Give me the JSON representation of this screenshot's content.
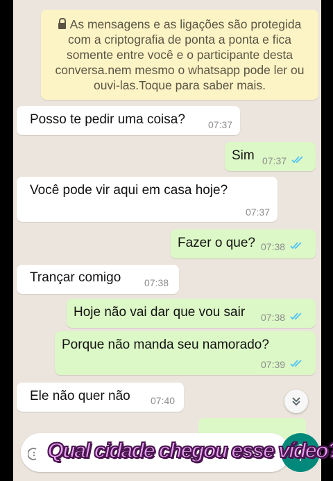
{
  "encryption_notice": "As mensagens e as ligações são protegida com a criptografia de ponta a ponta e fica somente entre você e o participante desta conversa.nem mesmo o whatsapp pode ler ou ouvi-las.Toque para saber mais.",
  "messages": [
    {
      "direction": "in",
      "text": "Posso te pedir uma coisa?",
      "time": "07:37"
    },
    {
      "direction": "out",
      "text": "Sim",
      "time": "07:37",
      "read": true
    },
    {
      "direction": "in",
      "text": "Você pode vir aqui em casa hoje?",
      "time": "07:37"
    },
    {
      "direction": "out",
      "text": "Fazer o que?",
      "time": "07:38",
      "read": true
    },
    {
      "direction": "in",
      "text": "Trançar comigo",
      "time": "07:38"
    },
    {
      "direction": "out",
      "text": "Hoje não vai dar que vou sair",
      "time": "07:38",
      "read": true
    },
    {
      "direction": "out",
      "text": "Porque não manda seu namorado?",
      "time": "07:39",
      "read": true
    },
    {
      "direction": "in",
      "text": "Ele não quer não",
      "time": "07:40"
    }
  ],
  "overlay_caption": "Qual cidade chegou esse vídeo?",
  "icons": {
    "lock": "lock-icon",
    "read_receipt": "double-check-icon",
    "scroll_down": "double-chevron-down-icon",
    "emoji": "emoji-icon",
    "mic": "mic-icon"
  },
  "colors": {
    "chat_background": "#ece5dd",
    "incoming_bubble": "#ffffff",
    "outgoing_bubble": "#dcf8c6",
    "notice_background": "#fdf4c5",
    "read_tick": "#4fc3f7",
    "accent": "#00897b",
    "caption_fill": "#e9a2f2",
    "caption_outline": "#4a1650"
  }
}
